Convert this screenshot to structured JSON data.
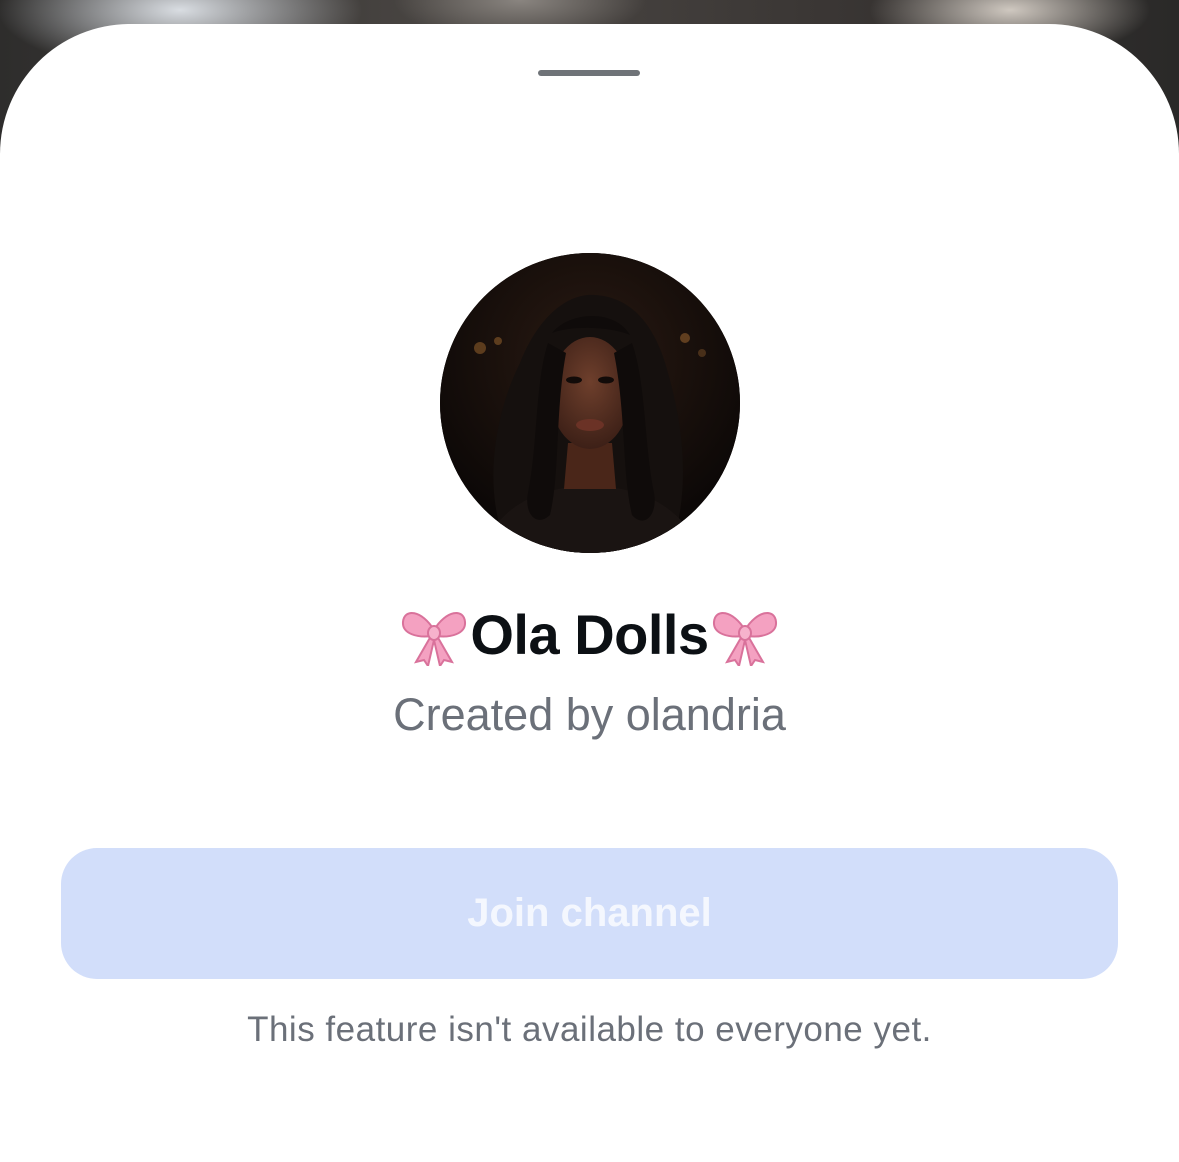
{
  "channel": {
    "title": "Ola Dolls",
    "title_prefix_icon": "pink-bow-emoji",
    "title_suffix_icon": "pink-bow-emoji",
    "creator_line": "Created by olandria"
  },
  "actions": {
    "join_label": "Join channel",
    "join_state": "disabled"
  },
  "notice": {
    "text": "This feature isn't available to everyone yet."
  },
  "colors": {
    "sheet_background": "#ffffff",
    "title": "#0c1014",
    "secondary_text": "#6b7079",
    "button_disabled_background": "#d2defa",
    "button_disabled_text": "#f4f7fe",
    "bow": "#f4a1c1"
  }
}
